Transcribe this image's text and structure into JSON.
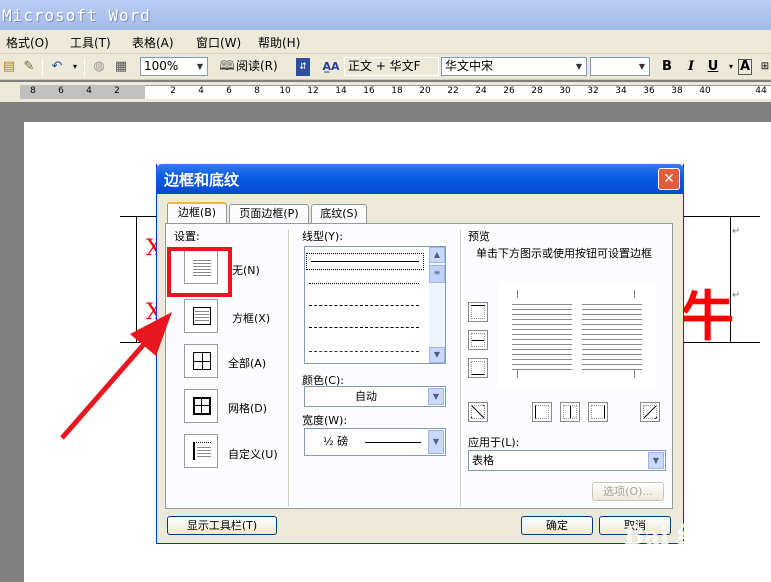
{
  "window": {
    "title": "Microsoft Word"
  },
  "menu": {
    "items": [
      "格式(O)",
      "工具(T)",
      "表格(A)",
      "窗口(W)",
      "帮助(H)"
    ]
  },
  "toolbar": {
    "zoom": "100%",
    "read_button": "阅读(R)",
    "style": "正文 + 华文F",
    "font": "华文中宋",
    "size": "",
    "bold": "B",
    "italic": "I",
    "underline": "U",
    "font_color": "A"
  },
  "ruler": {
    "numbers": [
      "8",
      "6",
      "4",
      "2",
      "2",
      "4",
      "6",
      "8",
      "10",
      "12",
      "14",
      "16",
      "18",
      "20",
      "22",
      "24",
      "26",
      "28",
      "30",
      "32",
      "34",
      "36",
      "38",
      "40",
      "44"
    ]
  },
  "document": {
    "red_marks": [
      "X",
      "X",
      "牛"
    ],
    "para_marks": [
      "↵",
      "↵"
    ]
  },
  "dialog": {
    "title": "边框和底纹",
    "close_icon": "close-icon",
    "tabs": [
      "边框(B)",
      "页面边框(P)",
      "底纹(S)"
    ],
    "settings_label": "设置:",
    "settings": [
      {
        "label": "无(N)",
        "icon": "border-none-icon"
      },
      {
        "label": "方框(X)",
        "icon": "border-box-icon"
      },
      {
        "label": "全部(A)",
        "icon": "border-all-icon"
      },
      {
        "label": "网格(D)",
        "icon": "border-grid-icon"
      },
      {
        "label": "自定义(U)",
        "icon": "border-custom-icon"
      }
    ],
    "line_style_label": "线型(Y):",
    "color_label": "颜色(C):",
    "color_value": "自动",
    "width_label": "宽度(W):",
    "width_value": "½ 磅",
    "preview_label": "预览",
    "preview_hint": "单击下方图示或使用按钮可设置边框",
    "apply_label": "应用于(L):",
    "apply_value": "表格",
    "options_button": "选项(O)...",
    "show_toolbar_button": "显示工具栏(T)",
    "ok_button": "确定",
    "cancel_button": "取消",
    "highlight_color": "#e8171f"
  },
  "watermark": {
    "line1": "Bai 经验",
    "line2": "jingyan.baidu.com"
  }
}
